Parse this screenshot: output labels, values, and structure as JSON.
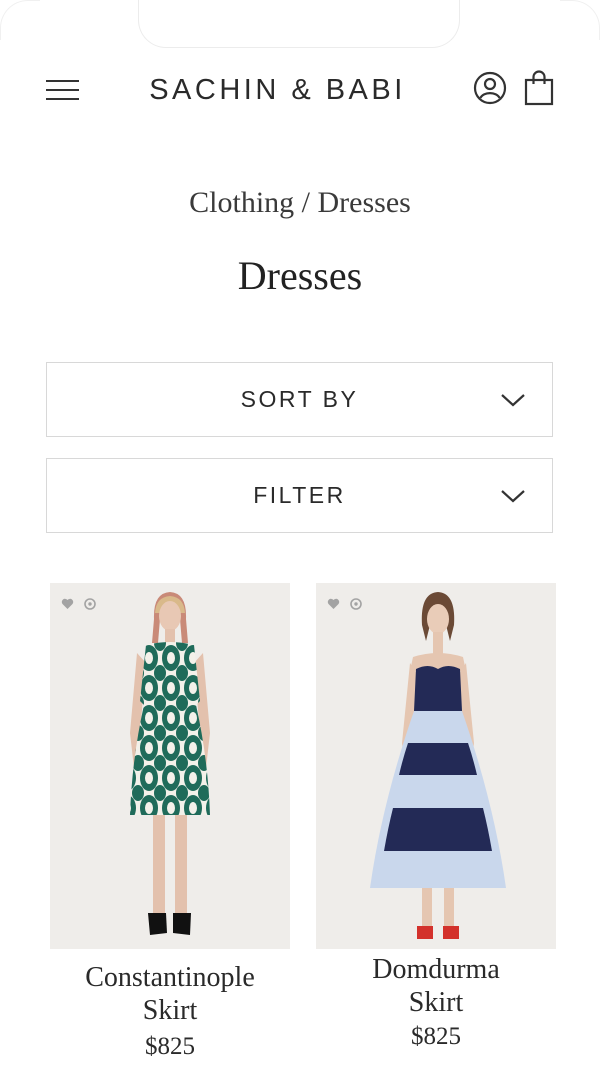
{
  "header": {
    "brand": "SACHIN & BABI",
    "menu_icon": "hamburger-menu-icon",
    "account_icon": "account-icon",
    "bag_icon": "shopping-bag-icon"
  },
  "breadcrumb": {
    "parent": "Clothing",
    "separator": " / ",
    "current": "Dresses"
  },
  "page_title": "Dresses",
  "controls": {
    "sort_label": "SORT BY",
    "filter_label": "FILTER",
    "chevron_icon": "chevron-down-icon"
  },
  "products": [
    {
      "name_line1": "Constantinople",
      "name_line2": "Skirt",
      "price": "$825",
      "icons": [
        "heart-icon",
        "pinterest-icon"
      ]
    },
    {
      "name_line1": "Domdurma",
      "name_line2": "Skirt",
      "price": "$825",
      "icons": [
        "heart-icon",
        "pinterest-icon"
      ]
    }
  ],
  "colors": {
    "text": "#222222",
    "border": "#d8d8d8",
    "photo_background": "#efedea",
    "dress1_green": "#1f6b5a",
    "dress2_navy": "#232a56",
    "dress2_lightblue": "#c9d7ec"
  }
}
